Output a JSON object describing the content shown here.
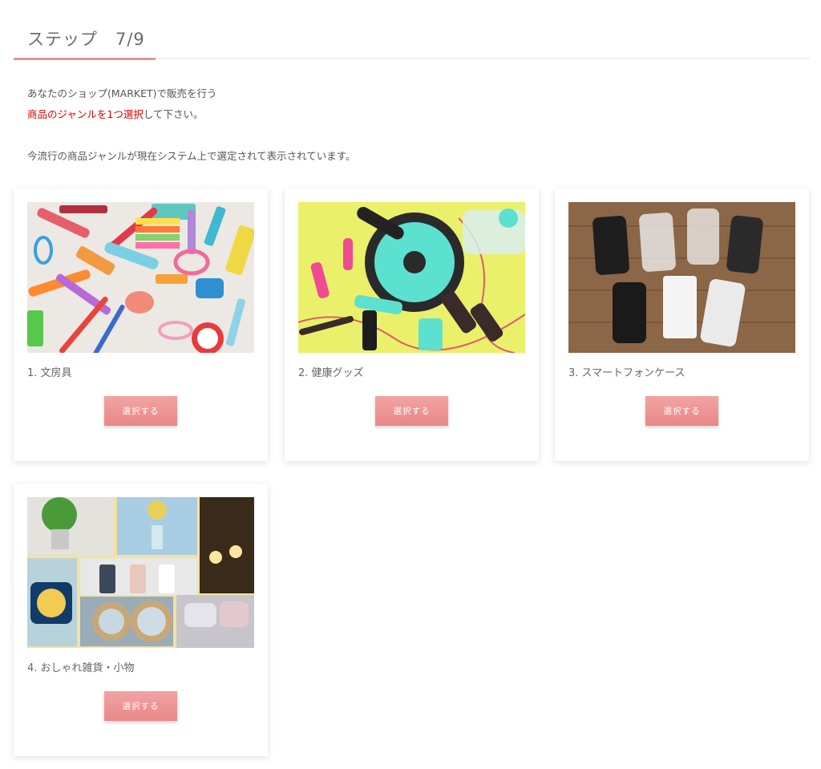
{
  "step": {
    "title": "ステップ　7/9"
  },
  "intro": {
    "line1": "あなたのショップ(MARKET)で販売を行う",
    "line2_highlight": "商品のジャンルを1つ選択",
    "line2_rest": "して下さい。",
    "line3": "今流行の商品ジャンルが現在システム上で選定されて表示されています。"
  },
  "cards": [
    {
      "label": "1. 文房具",
      "button": "選択する",
      "image": "stationery-photo"
    },
    {
      "label": "2. 健康グッズ",
      "button": "選択する",
      "image": "fitness-goods-photo"
    },
    {
      "label": "3. スマートフォンケース",
      "button": "選択する",
      "image": "smartphone-cases-photo"
    },
    {
      "label": "4. おしゃれ雑貨・小物",
      "button": "選択する",
      "image": "interior-goods-collage"
    }
  ],
  "colors": {
    "accent": "#e7948f",
    "button": "#ec9191",
    "highlight": "#e00000"
  }
}
